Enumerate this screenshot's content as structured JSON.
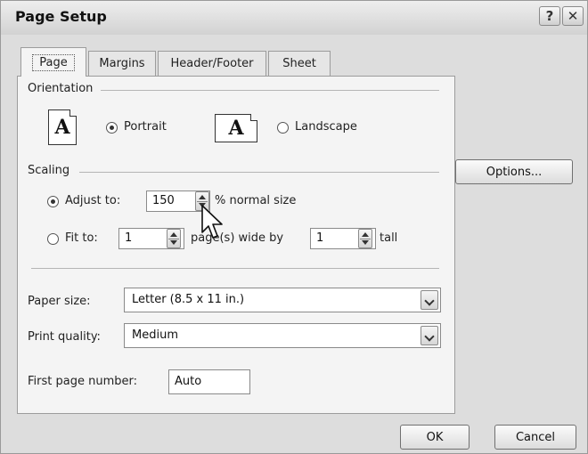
{
  "window": {
    "title": "Page Setup",
    "help_label": "?",
    "close_label": "✕"
  },
  "tabs": [
    {
      "label": "Page",
      "active": true
    },
    {
      "label": "Margins",
      "active": false
    },
    {
      "label": "Header/Footer",
      "active": false
    },
    {
      "label": "Sheet",
      "active": false
    }
  ],
  "orientation": {
    "group_label": "Orientation",
    "portrait_icon_glyph": "A",
    "landscape_icon_glyph": "A",
    "portrait_label": "Portrait",
    "landscape_label": "Landscape",
    "selected": "portrait"
  },
  "scaling": {
    "group_label": "Scaling",
    "adjust_to_label": "Adjust to:",
    "adjust_value": "150",
    "normal_size_label": "% normal size",
    "fit_to_label": "Fit to:",
    "fit_wide_value": "1",
    "pages_wide_label": "page(s) wide by",
    "fit_tall_value": "1",
    "tall_label": "tall",
    "selected": "adjust"
  },
  "options_button": "Options...",
  "paper_size": {
    "label": "Paper size:",
    "value": "Letter (8.5 x 11 in.)"
  },
  "print_quality": {
    "label": "Print quality:",
    "value": "Medium"
  },
  "first_page_number": {
    "label": "First page number:",
    "value": "Auto"
  },
  "footer": {
    "ok": "OK",
    "cancel": "Cancel"
  },
  "icons": [
    "help-icon",
    "close-icon",
    "portrait-page-icon",
    "landscape-page-icon",
    "spin-up-icon",
    "spin-down-icon",
    "dropdown-arrow-icon",
    "mouse-cursor-icon"
  ]
}
